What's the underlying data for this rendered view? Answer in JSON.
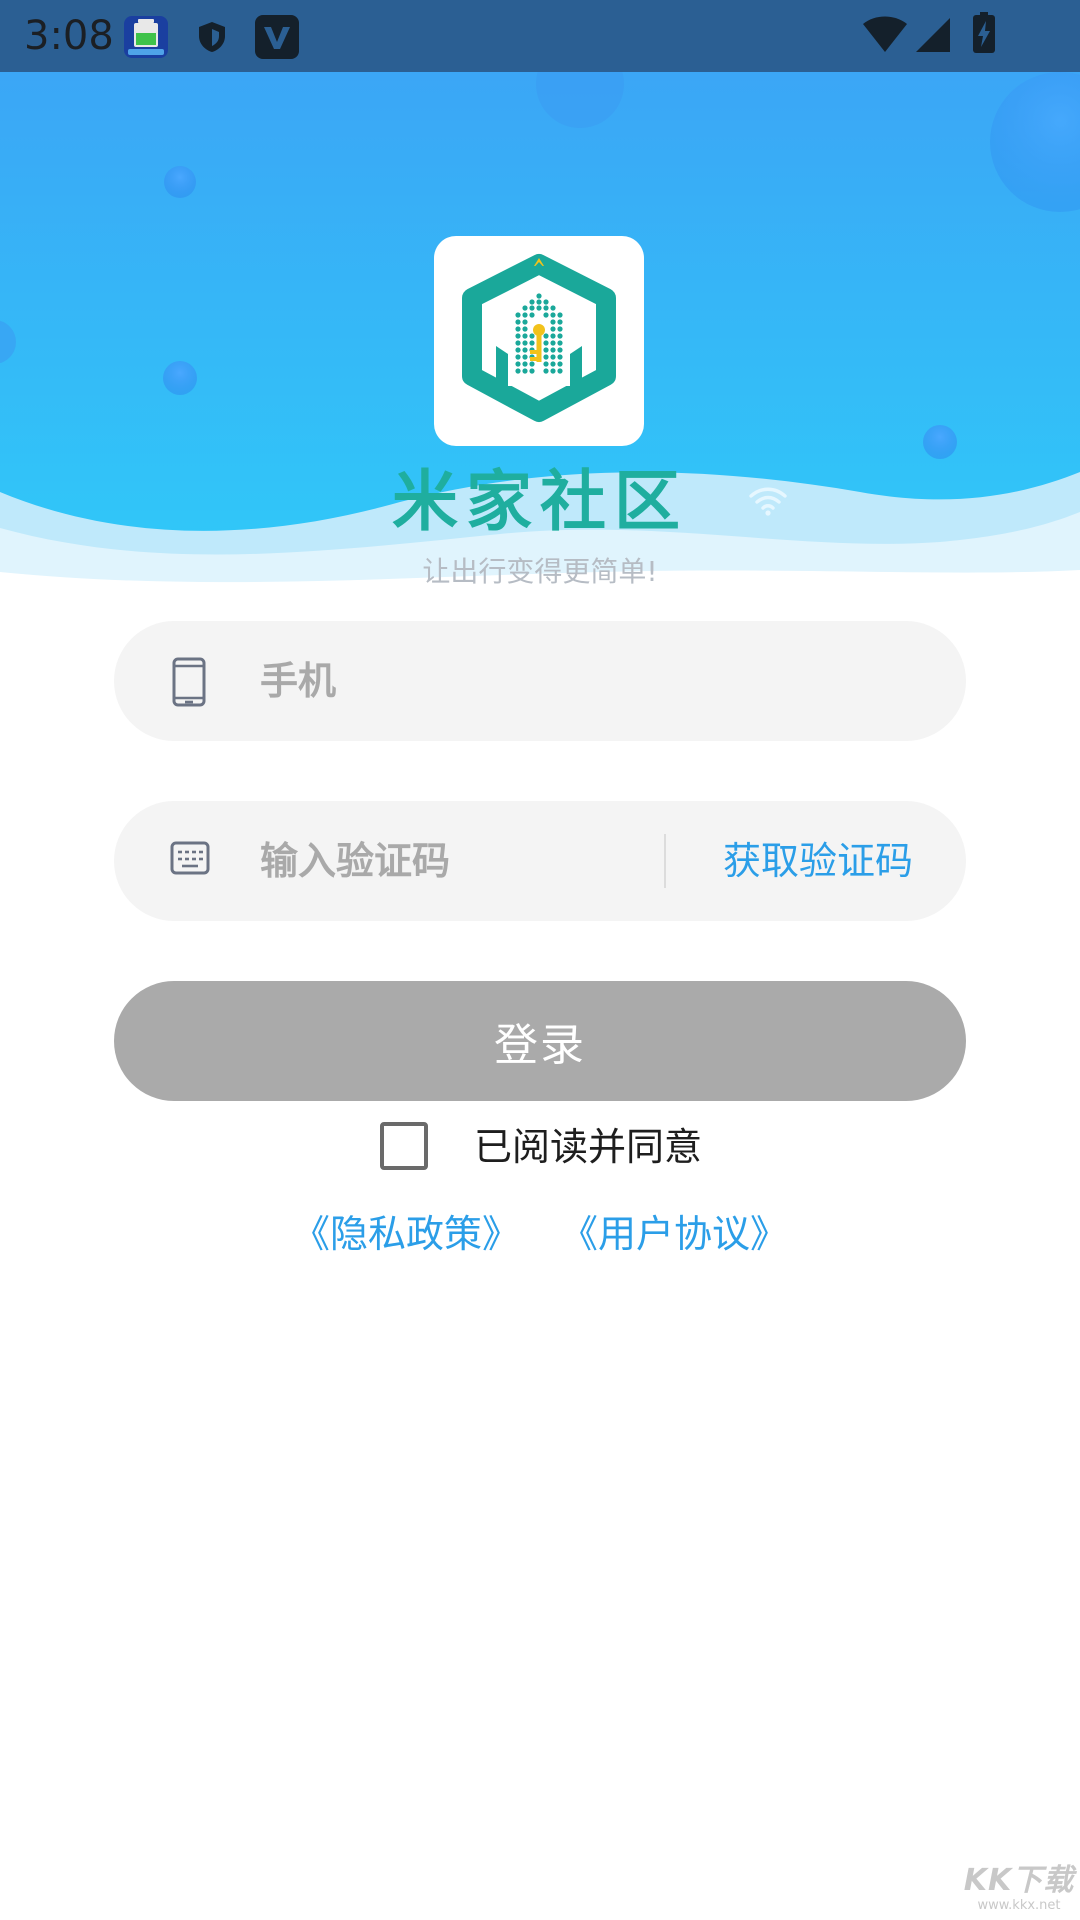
{
  "status_bar": {
    "time": "3:08",
    "icons": [
      "battery-app-icon",
      "shield-icon",
      "v-app-icon",
      "wifi-icon",
      "cell-signal-icon",
      "battery-charging-icon"
    ]
  },
  "header": {
    "app_name": "米家社区",
    "slogan": "让出行变得更简单!",
    "logo_icon": "community-house-key-logo"
  },
  "login_form": {
    "phone_placeholder": "手机",
    "code_placeholder": "输入验证码",
    "get_code_label": "获取验证码",
    "login_label": "登录"
  },
  "agreement": {
    "text": "已阅读并同意",
    "privacy_label": "《隐私政策》",
    "user_agreement_label": "《用户协议》"
  },
  "watermark": {
    "main": "KK下载",
    "sub": "www.kkx.net"
  },
  "colors": {
    "status_bar": "#2b5f93",
    "accent_blue": "#2b9ee8",
    "brand_teal": "#1fae9f",
    "button_disabled": "#aaaaaa",
    "field_bg": "#f4f4f4"
  }
}
